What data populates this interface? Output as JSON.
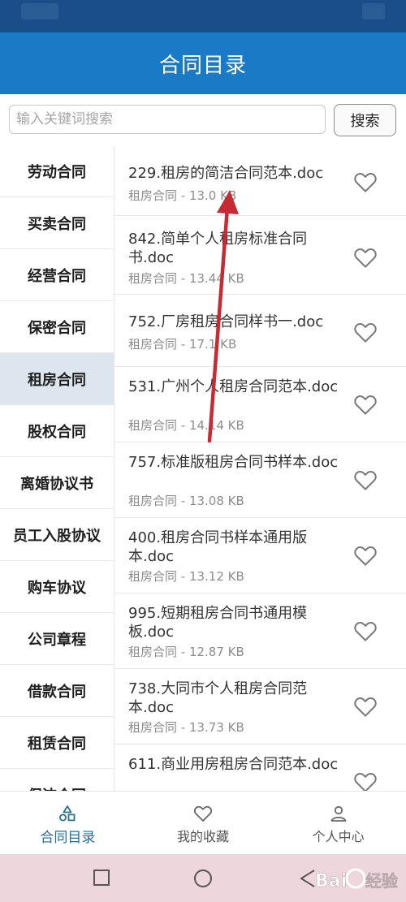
{
  "app": {
    "title": "合同目录"
  },
  "search": {
    "placeholder": "输入关键词搜索",
    "button_label": "搜索"
  },
  "categories": [
    {
      "label": "劳动合同",
      "active": false
    },
    {
      "label": "买卖合同",
      "active": false
    },
    {
      "label": "经营合同",
      "active": false
    },
    {
      "label": "保密合同",
      "active": false
    },
    {
      "label": "租房合同",
      "active": true
    },
    {
      "label": "股权合同",
      "active": false
    },
    {
      "label": "离婚协议书",
      "active": false
    },
    {
      "label": "员工入股协议",
      "active": false
    },
    {
      "label": "购车协议",
      "active": false
    },
    {
      "label": "公司章程",
      "active": false
    },
    {
      "label": "借款合同",
      "active": false
    },
    {
      "label": "租赁合同",
      "active": false
    },
    {
      "label": "保洁合同",
      "active": false
    }
  ],
  "documents": [
    {
      "name": "229.租房的简洁合同范本.doc",
      "meta": "租房合同 - 13.0 KB"
    },
    {
      "name": "842.简单个人租房标准合同书.doc",
      "meta": "租房合同 - 13.44 KB"
    },
    {
      "name": "752.厂房租房合同样书一.doc",
      "meta": "租房合同 - 17.1 KB"
    },
    {
      "name": "531.广州个人租房合同范本.doc",
      "meta": "租房合同 - 14.14 KB"
    },
    {
      "name": "757.标准版租房合同书样本.doc",
      "meta": "租房合同 - 13.08 KB"
    },
    {
      "name": "400.租房合同书样本通用版本.doc",
      "meta": "租房合同 - 13.12 KB"
    },
    {
      "name": "995.短期租房合同书通用模板.doc",
      "meta": "租房合同 - 12.87 KB"
    },
    {
      "name": "738.大同市个人租房合同范本.doc",
      "meta": "租房合同 - 13.73 KB"
    },
    {
      "name": "611.商业用房租房合同范本.doc",
      "meta": ""
    }
  ],
  "bottom_nav": [
    {
      "label": "合同目录",
      "icon": "shapes-icon",
      "active": true
    },
    {
      "label": "我的收藏",
      "icon": "heart-icon",
      "active": false
    },
    {
      "label": "个人中心",
      "icon": "person-icon",
      "active": false
    }
  ],
  "watermark": "Baidu经验",
  "colors": {
    "appbar": "#1a7ac6",
    "statusbar": "#1a4e8a",
    "active_category": "#dde6ef",
    "active_tab": "#2a6e93",
    "annotation_arrow": "#c62a32"
  }
}
